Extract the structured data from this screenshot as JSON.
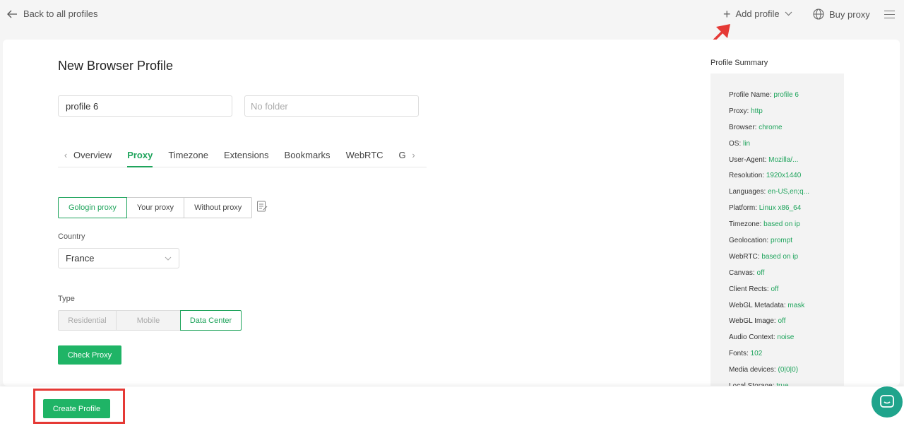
{
  "topbar": {
    "back_label": "Back to all profiles",
    "add_profile_label": "Add profile",
    "buy_proxy_label": "Buy proxy"
  },
  "form": {
    "title": "New Browser Profile",
    "profile_name_value": "profile 6",
    "folder_placeholder": "No folder"
  },
  "tabs": [
    {
      "label": "Overview"
    },
    {
      "label": "Proxy"
    },
    {
      "label": "Timezone"
    },
    {
      "label": "Extensions"
    },
    {
      "label": "Bookmarks"
    },
    {
      "label": "WebRTC"
    },
    {
      "label": "G"
    }
  ],
  "active_tab": "Proxy",
  "proxy": {
    "options": [
      "Gologin proxy",
      "Your proxy",
      "Without proxy"
    ],
    "selected": "Gologin proxy",
    "country_label": "Country",
    "country_value": "France",
    "type_label": "Type",
    "types": [
      "Residential",
      "Mobile",
      "Data Center"
    ],
    "selected_type": "Data Center",
    "check_button": "Check Proxy"
  },
  "summary": {
    "title": "Profile Summary",
    "rows": [
      {
        "key": "Profile Name:",
        "value": "profile 6"
      },
      {
        "key": "Proxy:",
        "value": "http"
      },
      {
        "key": "Browser:",
        "value": "chrome"
      },
      {
        "key": "OS:",
        "value": "lin"
      },
      {
        "key": "User-Agent:",
        "value": "Mozilla/..."
      },
      {
        "key": "Resolution:",
        "value": "1920x1440"
      },
      {
        "key": "Languages:",
        "value": "en-US,en;q..."
      },
      {
        "key": "Platform:",
        "value": "Linux x86_64"
      },
      {
        "key": "Timezone:",
        "value": "based on ip"
      },
      {
        "key": "Geolocation:",
        "value": "prompt"
      },
      {
        "key": "WebRTC:",
        "value": "based on ip"
      },
      {
        "key": "Canvas:",
        "value": "off"
      },
      {
        "key": "Client Rects:",
        "value": "off"
      },
      {
        "key": "WebGL Metadata:",
        "value": "mask"
      },
      {
        "key": "WebGL Image:",
        "value": "off"
      },
      {
        "key": "Audio Context:",
        "value": "noise"
      },
      {
        "key": "Fonts:",
        "value": "102"
      },
      {
        "key": "Media devices:",
        "value": "(0|0|0)"
      },
      {
        "key": "Local Storage:",
        "value": "true"
      }
    ]
  },
  "bottom": {
    "create_label": "Create Profile"
  },
  "colors": {
    "accent": "#1fa45c",
    "button": "#1fb466",
    "annotation": "#e53935",
    "chat": "#1fa48c"
  }
}
